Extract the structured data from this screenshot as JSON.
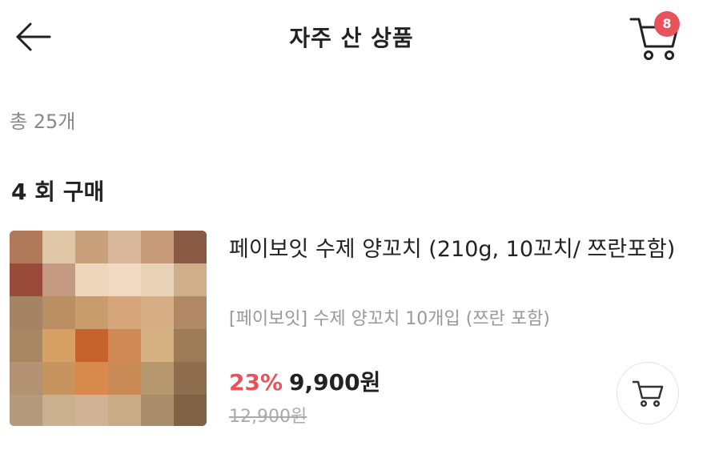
{
  "header": {
    "title": "자주 산 상품",
    "cart_count": "8"
  },
  "total_label": "총 25개",
  "section": {
    "title": "4 회 구매"
  },
  "product": {
    "name": "페이보잇 수제 양꼬치 (210g, 10꼬치/ 쯔란포함)",
    "subtitle": "[페이보잇] 수제 양꼬치 10개입 (쯔란 포함)",
    "discount": "23%",
    "price": "9,900원",
    "original_price": "12,900원",
    "image_icon": "blurred-product-photo"
  },
  "colors": {
    "accent": "#e8525a",
    "muted": "#888888"
  }
}
